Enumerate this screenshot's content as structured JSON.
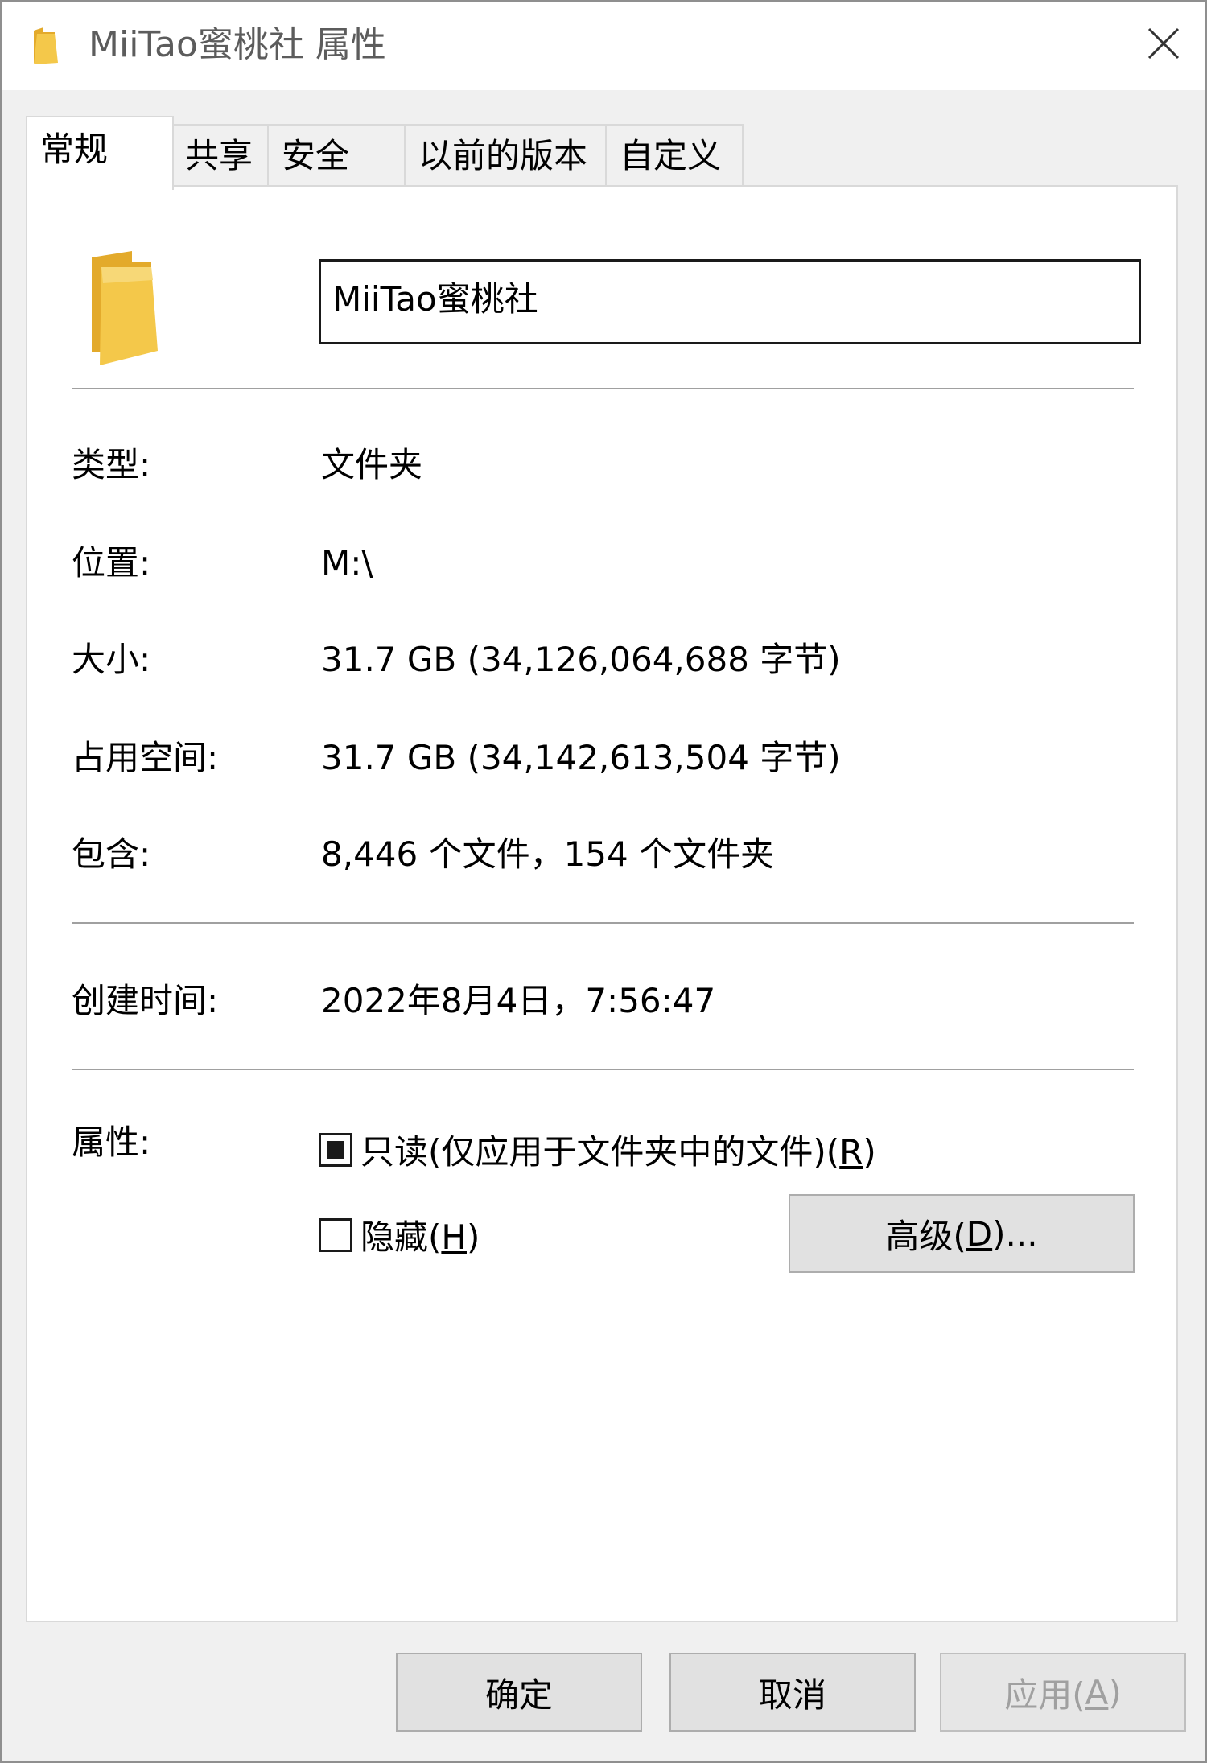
{
  "window": {
    "title": "MiiTao蜜桃社 属性"
  },
  "tabs": [
    {
      "label": "常规"
    },
    {
      "label": "共享"
    },
    {
      "label": "安全"
    },
    {
      "label": "以前的版本"
    },
    {
      "label": "自定义"
    }
  ],
  "general": {
    "name_value": "MiiTao蜜桃社",
    "type_label": "类型:",
    "type_value": "文件夹",
    "location_label": "位置:",
    "location_value": "M:\\",
    "size_label": "大小:",
    "size_value": "31.7 GB (34,126,064,688 字节)",
    "size_on_disk_label": "占用空间:",
    "size_on_disk_value": "31.7 GB (34,142,613,504 字节)",
    "contains_label": "包含:",
    "contains_value": "8,446 个文件，154 个文件夹",
    "created_label": "创建时间:",
    "created_value": "2022年8月4日，7:56:47",
    "attributes_label": "属性:",
    "readonly": {
      "label": "只读(仅应用于文件夹中的文件)(",
      "hotkey": "R",
      "suffix": ")",
      "state": "indeterminate"
    },
    "hidden": {
      "label": "隐藏(",
      "hotkey": "H",
      "suffix": ")",
      "checked": false
    },
    "advanced": {
      "label": "高级(",
      "hotkey": "D",
      "suffix": ")..."
    }
  },
  "footer": {
    "ok_label": "确定",
    "cancel_label": "取消",
    "apply": {
      "label": "应用(",
      "hotkey": "A",
      "suffix": ")",
      "enabled": false
    }
  },
  "colors": {
    "folder_yellow": "#f4c84a",
    "folder_shade": "#e3aa2b",
    "chrome_bg": "#f0f0f0"
  }
}
